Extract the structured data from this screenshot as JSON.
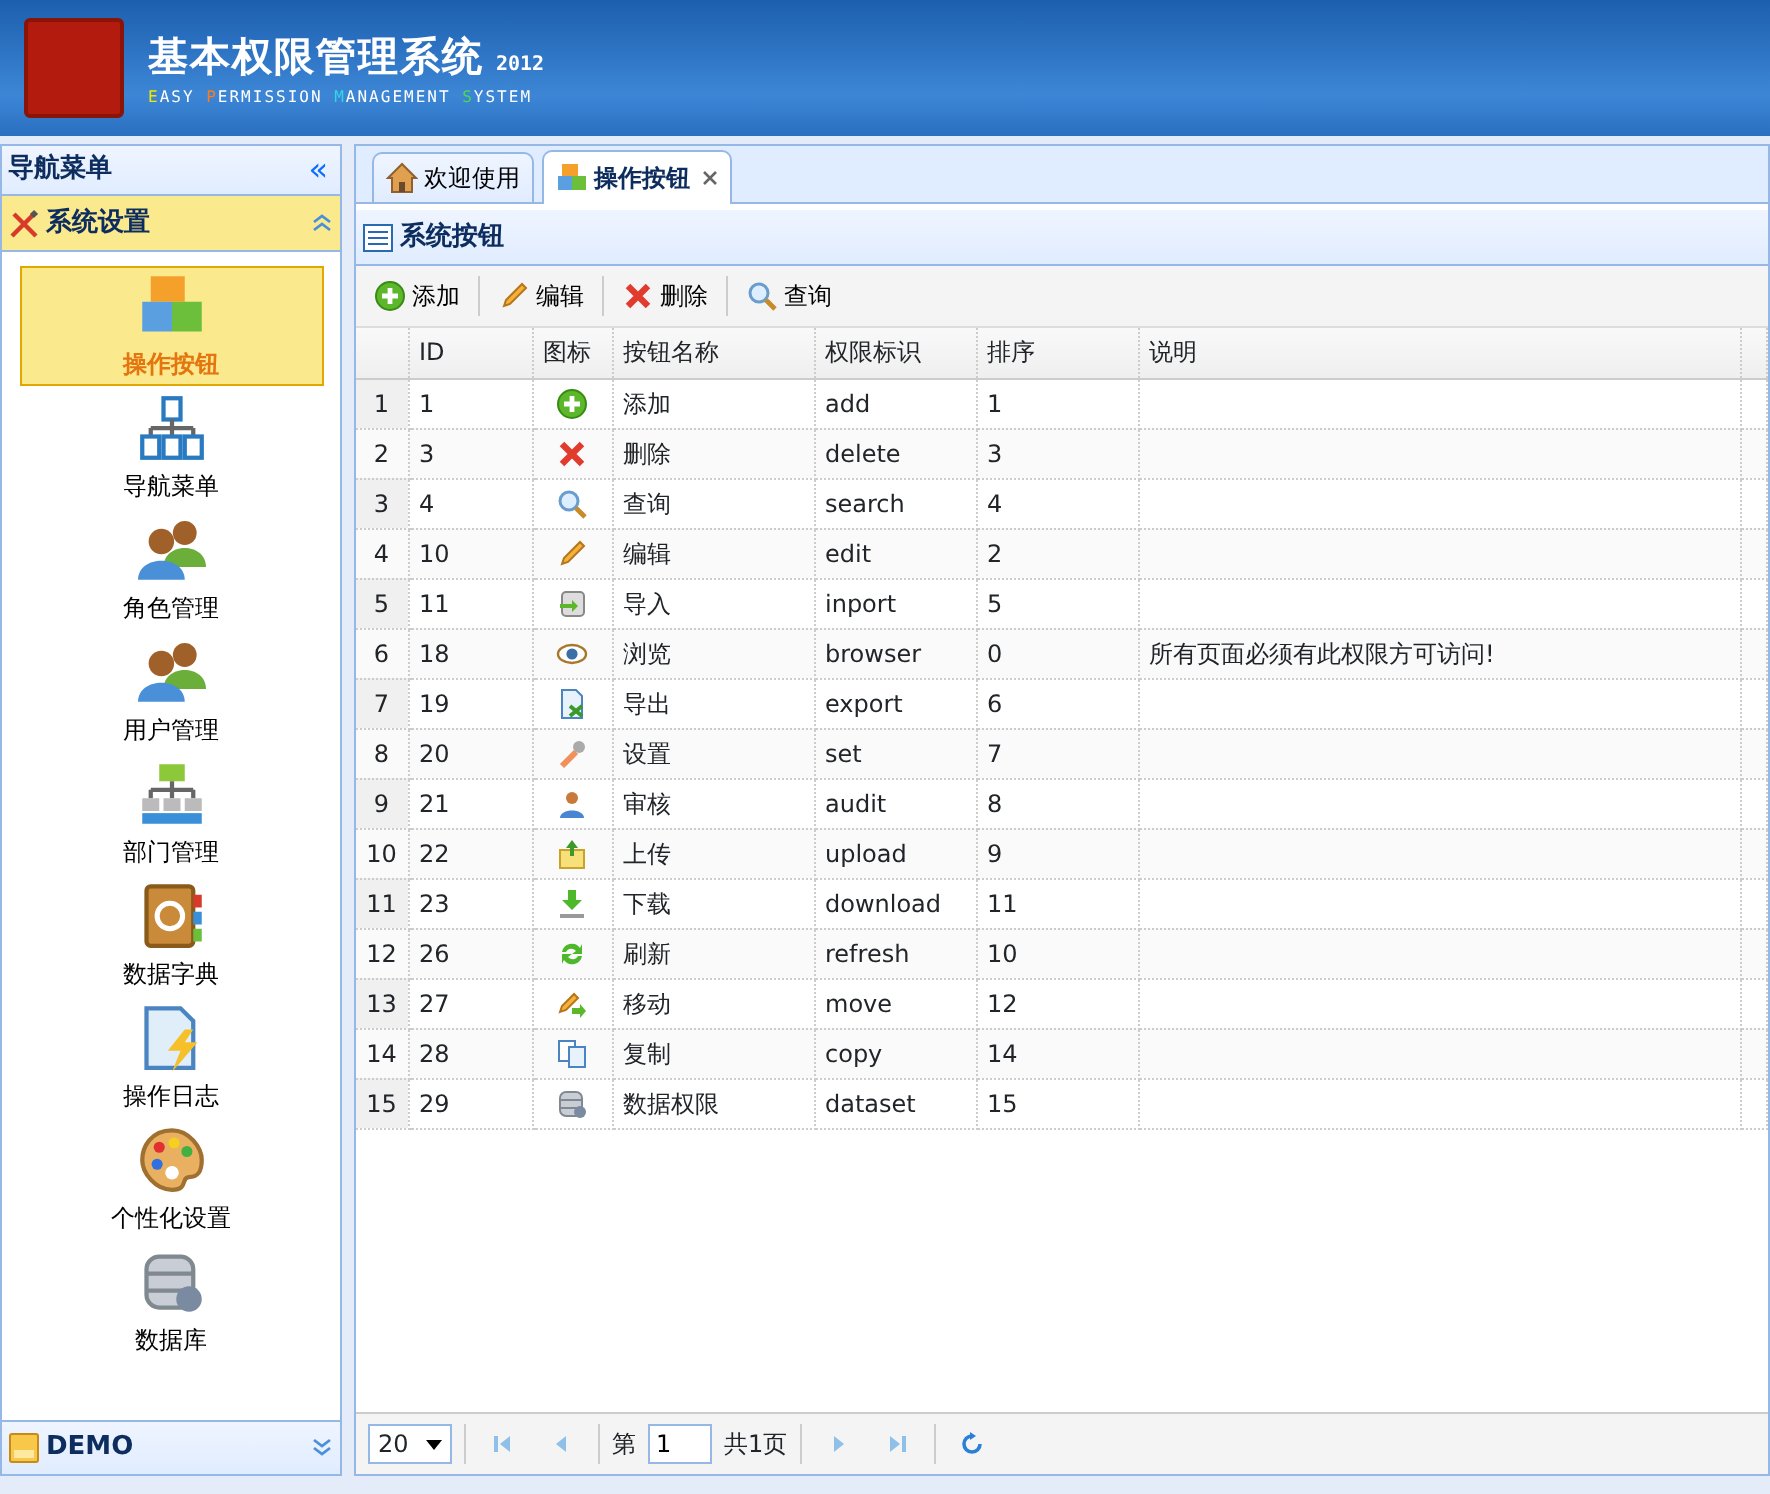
{
  "header": {
    "title": "基本权限管理系统",
    "year": "2012",
    "subtitle": [
      {
        "text": "EASY",
        "color": "#f5e600"
      },
      {
        "text": "PERMISSION",
        "color": "#ff7a1a"
      },
      {
        "text": "MANAGEMENT",
        "color": "#33d6e6"
      },
      {
        "text": "SYSTEM",
        "color": "#4cd94c"
      }
    ]
  },
  "sidebar": {
    "title": "导航菜单",
    "collapse": "«",
    "group": {
      "label": "系统设置",
      "expanded": true
    },
    "items": [
      {
        "label": "操作按钮",
        "kind": "blocks",
        "selected": true
      },
      {
        "label": "导航菜单",
        "kind": "tree",
        "selected": false
      },
      {
        "label": "角色管理",
        "kind": "users",
        "selected": false
      },
      {
        "label": "用户管理",
        "kind": "users",
        "selected": false
      },
      {
        "label": "部门管理",
        "kind": "org",
        "selected": false
      },
      {
        "label": "数据字典",
        "kind": "book",
        "selected": false
      },
      {
        "label": "操作日志",
        "kind": "log",
        "selected": false
      },
      {
        "label": "个性化设置",
        "kind": "palette",
        "selected": false
      },
      {
        "label": "数据库",
        "kind": "database",
        "selected": false
      }
    ],
    "footer_group": {
      "label": "DEMO",
      "expanded": false
    }
  },
  "tabs": [
    {
      "label": "欢迎使用",
      "kind": "home",
      "selected": false,
      "closable": false
    },
    {
      "label": "操作按钮",
      "kind": "blocks",
      "selected": true,
      "closable": true
    }
  ],
  "panel": {
    "title": "系统按钮"
  },
  "toolbar": [
    {
      "label": "添加",
      "kind": "add"
    },
    {
      "label": "编辑",
      "kind": "edit"
    },
    {
      "label": "删除",
      "kind": "delete"
    },
    {
      "label": "查询",
      "kind": "search"
    }
  ],
  "table": {
    "columns": [
      "ID",
      "图标",
      "按钮名称",
      "权限标识",
      "排序",
      "说明"
    ],
    "rows": [
      {
        "num": "1",
        "id": "1",
        "kind": "add",
        "name": "添加",
        "code": "add",
        "order": "1",
        "note": ""
      },
      {
        "num": "2",
        "id": "3",
        "kind": "delete",
        "name": "删除",
        "code": "delete",
        "order": "3",
        "note": ""
      },
      {
        "num": "3",
        "id": "4",
        "kind": "search",
        "name": "查询",
        "code": "search",
        "order": "4",
        "note": ""
      },
      {
        "num": "4",
        "id": "10",
        "kind": "edit",
        "name": "编辑",
        "code": "edit",
        "order": "2",
        "note": ""
      },
      {
        "num": "5",
        "id": "11",
        "kind": "import",
        "name": "导入",
        "code": "inport",
        "order": "5",
        "note": ""
      },
      {
        "num": "6",
        "id": "18",
        "kind": "eye",
        "name": "浏览",
        "code": "browser",
        "order": "0",
        "note": "所有页面必须有此权限方可访问!"
      },
      {
        "num": "7",
        "id": "19",
        "kind": "export",
        "name": "导出",
        "code": "export",
        "order": "6",
        "note": ""
      },
      {
        "num": "8",
        "id": "20",
        "kind": "wrench",
        "name": "设置",
        "code": "set",
        "order": "7",
        "note": ""
      },
      {
        "num": "9",
        "id": "21",
        "kind": "audit",
        "name": "审核",
        "code": "audit",
        "order": "8",
        "note": ""
      },
      {
        "num": "10",
        "id": "22",
        "kind": "upload",
        "name": "上传",
        "code": "upload",
        "order": "9",
        "note": ""
      },
      {
        "num": "11",
        "id": "23",
        "kind": "download",
        "name": "下载",
        "code": "download",
        "order": "11",
        "note": ""
      },
      {
        "num": "12",
        "id": "26",
        "kind": "refresh",
        "name": "刷新",
        "code": "refresh",
        "order": "10",
        "note": ""
      },
      {
        "num": "13",
        "id": "27",
        "kind": "move",
        "name": "移动",
        "code": "move",
        "order": "12",
        "note": ""
      },
      {
        "num": "14",
        "id": "28",
        "kind": "copy",
        "name": "复制",
        "code": "copy",
        "order": "14",
        "note": ""
      },
      {
        "num": "15",
        "id": "29",
        "kind": "dataset",
        "name": "数据权限",
        "code": "dataset",
        "order": "15",
        "note": ""
      }
    ]
  },
  "pager": {
    "page_size": "20",
    "page_prefix": "第",
    "page": "1",
    "page_total": "共1页"
  }
}
